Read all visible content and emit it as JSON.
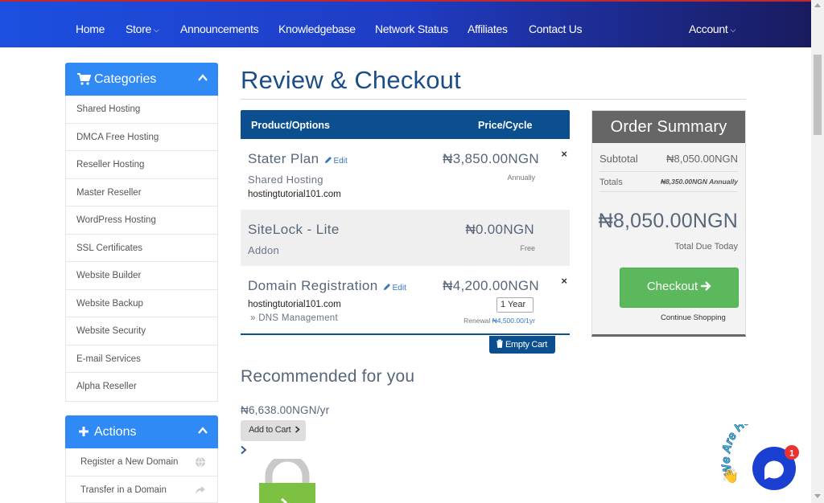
{
  "nav": {
    "items": [
      {
        "label": "Home"
      },
      {
        "label": "Store",
        "caret": "⌄"
      },
      {
        "label": "Announcements"
      },
      {
        "label": "Knowledgebase"
      },
      {
        "label": "Network Status"
      },
      {
        "label": "Affiliates"
      },
      {
        "label": "Contact Us"
      }
    ],
    "account": {
      "label": "Account",
      "caret": "⌄"
    }
  },
  "sidebar": {
    "categories": {
      "title": "Categories",
      "icon": "cart-icon",
      "items": [
        {
          "label": "Shared Hosting"
        },
        {
          "label": "DMCA Free Hosting"
        },
        {
          "label": "Reseller Hosting"
        },
        {
          "label": "Master Reseller"
        },
        {
          "label": "WordPress Hosting"
        },
        {
          "label": "SSL Certificates"
        },
        {
          "label": "Website Builder"
        },
        {
          "label": "Website Backup"
        },
        {
          "label": "Website Security"
        },
        {
          "label": "E-mail Services"
        },
        {
          "label": "Alpha Reseller"
        }
      ]
    },
    "actions": {
      "title": "Actions",
      "icon": "plus-icon",
      "items": [
        {
          "label": "Register a New Domain",
          "icon": "globe-icon"
        },
        {
          "label": "Transfer in a Domain",
          "icon": "share-icon"
        }
      ]
    }
  },
  "main": {
    "title": "Review & Checkout",
    "cart": {
      "col_product": "Product/Options",
      "col_price": "Price/Cycle",
      "rows": [
        {
          "name": "Stater Plan",
          "edit": "Edit",
          "group": "Shared Hosting",
          "domain": "hostingtutorial101.com",
          "price": "₦3,850.00NGN",
          "cycle": "Annually",
          "remove": "×"
        },
        {
          "name": "SiteLock - Lite",
          "group": "Addon",
          "price": "₦0.00NGN",
          "cycle": "Free"
        },
        {
          "name": "Domain Registration",
          "edit": "Edit",
          "domain": "hostingtutorial101.com",
          "addon": "» DNS Management",
          "price": "₦4,200.00NGN",
          "term": "1 Year",
          "renewal_label": "Renewal",
          "renewal_value": "₦4,500.00/1yr",
          "remove": "×"
        }
      ],
      "empty_button": "Empty Cart"
    },
    "summary": {
      "title": "Order Summary",
      "subtotal_label": "Subtotal",
      "subtotal_value": "₦8,050.00NGN",
      "totals_label": "Totals",
      "totals_value": "₦8,350.00NGN Annually",
      "total_due": "₦8,050.00NGN",
      "total_due_label": "Total Due Today",
      "checkout_button": "Checkout",
      "continue_link": "Continue Shopping"
    },
    "recommended": {
      "title": "Recommended for you",
      "price": "₦6,638.00NGN/yr",
      "add_button": "Add to Cart"
    }
  },
  "chat": {
    "badge_text": "We Are Here!",
    "unread_count": "1"
  },
  "colors": {
    "nav_start": "#1c4fe0",
    "nav_end": "#1a1b5e",
    "sidebar_head": "#2f8af5",
    "cart_head": "#0b4f8e",
    "checkout_green": "#5cb85c",
    "chat_blue": "#1b3fd1",
    "badge_red": "#e8332f"
  }
}
